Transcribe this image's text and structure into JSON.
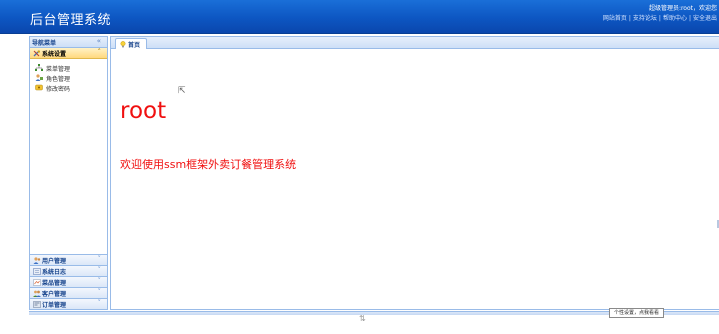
{
  "header": {
    "title": "后台管理系统",
    "greeting": "超级管理员:root，欢迎您",
    "links": [
      "网站首页",
      "支持论坛",
      "帮助中心",
      "安全退出"
    ]
  },
  "sidebar": {
    "title": "导航菜单",
    "collapse_glyph": "«",
    "active_group": {
      "label": "系统设置",
      "icon": "tools-icon",
      "items": [
        {
          "label": "菜单管理",
          "icon": "tree-icon"
        },
        {
          "label": "角色管理",
          "icon": "role-icon"
        },
        {
          "label": "修改密码",
          "icon": "key-icon"
        }
      ]
    },
    "groups": [
      {
        "label": "用户管理",
        "icon": "user-icon"
      },
      {
        "label": "系统日志",
        "icon": "log-icon"
      },
      {
        "label": "菜品管理",
        "icon": "dish-icon"
      },
      {
        "label": "客户管理",
        "icon": "customer-icon"
      },
      {
        "label": "订单管理",
        "icon": "order-icon"
      }
    ]
  },
  "main": {
    "tab_label": "首页",
    "username": "root",
    "welcome_text": "欢迎使用ssm框架外卖订餐管理系统"
  },
  "tooltip": "个性设置，点我看看",
  "colors": {
    "header_blue": "#0d56c2",
    "accent_red": "#f01010",
    "panel_border": "#99bbe8",
    "active_yellow": "#ffd87d"
  }
}
